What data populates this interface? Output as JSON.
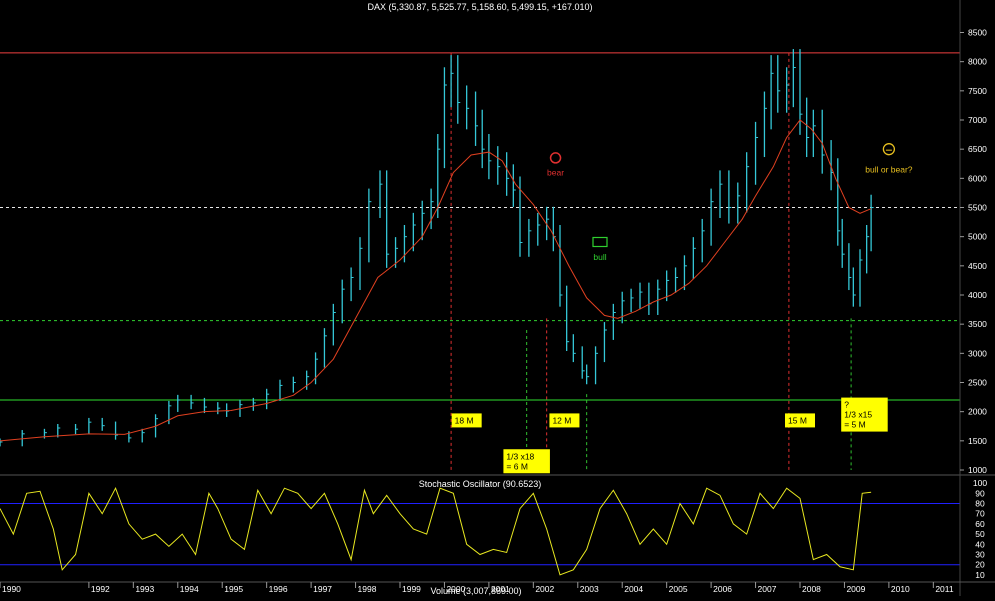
{
  "chart_data": [
    {
      "type": "ohlc",
      "title": "DAX (5,330.87, 5,525.77, 5,158.60, 5,499.15, +167.010)",
      "ylim": [
        1000,
        8800
      ],
      "yticks": [
        1000,
        1500,
        2000,
        2500,
        3000,
        3500,
        4000,
        4500,
        5000,
        5500,
        6000,
        6500,
        7000,
        7500,
        8000,
        8500
      ],
      "xlim": [
        1990.0,
        2011.6
      ],
      "xticks": [
        "1990",
        "1992",
        "1993",
        "1994",
        "1995",
        "1996",
        "1997",
        "1998",
        "1999",
        "2000",
        "2001",
        "2002",
        "2003",
        "2004",
        "2005",
        "2006",
        "2007",
        "2008",
        "2009",
        "2010",
        "2011"
      ],
      "xtick_years": [
        1990,
        1992,
        1993,
        1994,
        1995,
        1996,
        1997,
        1998,
        1999,
        2000,
        2001,
        2002,
        2003,
        2004,
        2005,
        2006,
        2007,
        2008,
        2009,
        2010,
        2011
      ],
      "grid": false,
      "series": [
        {
          "style": "bars",
          "color": "#35c8d8",
          "points": [
            [
              1990.0,
              1480
            ],
            [
              1990.5,
              1620
            ],
            [
              1991.0,
              1640
            ],
            [
              1991.3,
              1720
            ],
            [
              1991.7,
              1700
            ],
            [
              1992.0,
              1820
            ],
            [
              1992.3,
              1760
            ],
            [
              1992.6,
              1600
            ],
            [
              1992.9,
              1550
            ],
            [
              1993.2,
              1640
            ],
            [
              1993.5,
              1880
            ],
            [
              1993.8,
              2100
            ],
            [
              1994.0,
              2200
            ],
            [
              1994.3,
              2150
            ],
            [
              1994.6,
              2080
            ],
            [
              1994.9,
              2060
            ],
            [
              1995.1,
              2010
            ],
            [
              1995.4,
              2120
            ],
            [
              1995.7,
              2150
            ],
            [
              1996.0,
              2300
            ],
            [
              1996.3,
              2450
            ],
            [
              1996.6,
              2500
            ],
            [
              1996.9,
              2600
            ],
            [
              1997.1,
              2900
            ],
            [
              1997.3,
              3300
            ],
            [
              1997.5,
              3700
            ],
            [
              1997.7,
              4100
            ],
            [
              1997.9,
              4300
            ],
            [
              1998.1,
              4800
            ],
            [
              1998.3,
              5600
            ],
            [
              1998.55,
              5900
            ],
            [
              1998.7,
              4700
            ],
            [
              1998.9,
              4800
            ],
            [
              1999.1,
              5000
            ],
            [
              1999.3,
              5200
            ],
            [
              1999.5,
              5400
            ],
            [
              1999.7,
              5600
            ],
            [
              1999.85,
              6500
            ],
            [
              2000.0,
              7600
            ],
            [
              2000.15,
              7800
            ],
            [
              2000.3,
              7300
            ],
            [
              2000.5,
              7200
            ],
            [
              2000.7,
              6900
            ],
            [
              2000.85,
              6500
            ],
            [
              2001.0,
              6300
            ],
            [
              2001.2,
              6200
            ],
            [
              2001.4,
              6000
            ],
            [
              2001.55,
              5800
            ],
            [
              2001.7,
              4900
            ],
            [
              2001.9,
              5100
            ],
            [
              2002.1,
              5200
            ],
            [
              2002.3,
              5300
            ],
            [
              2002.45,
              5000
            ],
            [
              2002.6,
              4000
            ],
            [
              2002.75,
              3200
            ],
            [
              2002.9,
              3000
            ],
            [
              2003.1,
              2700
            ],
            [
              2003.2,
              2600
            ],
            [
              2003.4,
              3000
            ],
            [
              2003.6,
              3400
            ],
            [
              2003.8,
              3700
            ],
            [
              2004.0,
              3900
            ],
            [
              2004.2,
              3950
            ],
            [
              2004.4,
              4050
            ],
            [
              2004.6,
              3850
            ],
            [
              2004.8,
              4100
            ],
            [
              2005.0,
              4250
            ],
            [
              2005.2,
              4300
            ],
            [
              2005.4,
              4500
            ],
            [
              2005.6,
              4800
            ],
            [
              2005.8,
              5100
            ],
            [
              2006.0,
              5600
            ],
            [
              2006.2,
              5900
            ],
            [
              2006.4,
              5500
            ],
            [
              2006.6,
              5700
            ],
            [
              2006.8,
              6200
            ],
            [
              2007.0,
              6700
            ],
            [
              2007.2,
              7200
            ],
            [
              2007.35,
              7800
            ],
            [
              2007.5,
              7500
            ],
            [
              2007.7,
              7600
            ],
            [
              2007.85,
              7900
            ],
            [
              2008.0,
              7100
            ],
            [
              2008.15,
              6700
            ],
            [
              2008.3,
              6900
            ],
            [
              2008.5,
              6400
            ],
            [
              2008.7,
              6100
            ],
            [
              2008.85,
              5100
            ],
            [
              2008.95,
              4700
            ],
            [
              2009.1,
              4300
            ],
            [
              2009.2,
              4000
            ],
            [
              2009.35,
              4600
            ],
            [
              2009.5,
              5000
            ],
            [
              2009.6,
              5499
            ]
          ]
        },
        {
          "style": "line",
          "color": "#e04020",
          "points": [
            [
              1990.0,
              1500
            ],
            [
              1991.0,
              1570
            ],
            [
              1992.0,
              1620
            ],
            [
              1992.8,
              1610
            ],
            [
              1993.5,
              1750
            ],
            [
              1994.0,
              1930
            ],
            [
              1994.6,
              2000
            ],
            [
              1995.2,
              2020
            ],
            [
              1996.0,
              2140
            ],
            [
              1996.6,
              2280
            ],
            [
              1997.0,
              2500
            ],
            [
              1997.5,
              2900
            ],
            [
              1998.0,
              3600
            ],
            [
              1998.5,
              4300
            ],
            [
              1999.0,
              4600
            ],
            [
              1999.5,
              5000
            ],
            [
              1999.85,
              5500
            ],
            [
              2000.2,
              6100
            ],
            [
              2000.6,
              6400
            ],
            [
              2001.0,
              6450
            ],
            [
              2001.3,
              6300
            ],
            [
              2001.6,
              5900
            ],
            [
              2002.0,
              5550
            ],
            [
              2002.4,
              5100
            ],
            [
              2002.8,
              4500
            ],
            [
              2003.2,
              3950
            ],
            [
              2003.6,
              3650
            ],
            [
              2003.9,
              3600
            ],
            [
              2004.3,
              3720
            ],
            [
              2004.7,
              3880
            ],
            [
              2005.1,
              4000
            ],
            [
              2005.5,
              4200
            ],
            [
              2005.9,
              4500
            ],
            [
              2006.3,
              4900
            ],
            [
              2006.7,
              5300
            ],
            [
              2007.0,
              5700
            ],
            [
              2007.4,
              6200
            ],
            [
              2007.7,
              6700
            ],
            [
              2008.0,
              7000
            ],
            [
              2008.25,
              6850
            ],
            [
              2008.5,
              6600
            ],
            [
              2008.8,
              6000
            ],
            [
              2009.1,
              5500
            ],
            [
              2009.35,
              5400
            ],
            [
              2009.6,
              5480
            ]
          ]
        }
      ],
      "hlines": [
        {
          "y": 8150,
          "color": "#f04040",
          "style": "solid"
        },
        {
          "y": 5500,
          "color": "#e8e8e8",
          "style": "dashed"
        },
        {
          "y": 3560,
          "color": "#30d030",
          "style": "dashed"
        },
        {
          "y": 2200,
          "color": "#30e030",
          "style": "solid"
        }
      ],
      "vlines": [
        {
          "x": 2000.15,
          "y_from": 8150,
          "y_to": 1000,
          "color": "#e03030"
        },
        {
          "x": 2001.85,
          "y_from": 3400,
          "y_to": 1000,
          "color": "#30c030"
        },
        {
          "x": 2002.3,
          "y_from": 3600,
          "y_to": 1000,
          "color": "#e03030"
        },
        {
          "x": 2003.2,
          "y_from": 2300,
          "y_to": 1000,
          "color": "#30c030"
        },
        {
          "x": 2007.75,
          "y_from": 8150,
          "y_to": 1000,
          "color": "#e03030"
        },
        {
          "x": 2009.15,
          "y_from": 3600,
          "y_to": 1000,
          "color": "#30c030"
        }
      ],
      "annotations": [
        {
          "text": "18 M",
          "x": 2000.5,
          "y": 1850,
          "boxed": true
        },
        {
          "text": "1/3 x18 = 6 M",
          "x": 2001.85,
          "y": 1150,
          "boxed": true
        },
        {
          "text": "12 M",
          "x": 2002.7,
          "y": 1850,
          "boxed": true
        },
        {
          "text": "15 M",
          "x": 2008.0,
          "y": 1850,
          "boxed": true
        },
        {
          "text": "? 1/3 x15 = 5 M",
          "x": 2009.45,
          "y": 1950,
          "boxed": true
        },
        {
          "text": "bear",
          "x": 2002.5,
          "y": 6050,
          "color": "#e03030"
        },
        {
          "text": "bull",
          "x": 2003.5,
          "y": 4600,
          "color": "#30d030"
        },
        {
          "text": "bull or bear?",
          "x": 2010.0,
          "y": 6100,
          "color": "#e8c020"
        }
      ]
    },
    {
      "type": "line",
      "title": "Stochastic Oscillator (90.6523)",
      "ylim": [
        5,
        105
      ],
      "yticks": [
        10,
        20,
        30,
        40,
        50,
        60,
        70,
        80,
        90,
        100
      ],
      "hlines": [
        {
          "y": 80,
          "color": "#2020ff",
          "style": "solid"
        },
        {
          "y": 20,
          "color": "#2020ff",
          "style": "solid"
        }
      ],
      "series": [
        {
          "color": "#e8e820",
          "points": [
            [
              1990.0,
              75
            ],
            [
              1990.3,
              50
            ],
            [
              1990.6,
              90
            ],
            [
              1990.9,
              92
            ],
            [
              1991.2,
              55
            ],
            [
              1991.4,
              15
            ],
            [
              1991.7,
              30
            ],
            [
              1992.0,
              90
            ],
            [
              1992.3,
              70
            ],
            [
              1992.6,
              95
            ],
            [
              1992.9,
              60
            ],
            [
              1993.2,
              45
            ],
            [
              1993.5,
              50
            ],
            [
              1993.8,
              38
            ],
            [
              1994.1,
              50
            ],
            [
              1994.4,
              30
            ],
            [
              1994.7,
              90
            ],
            [
              1994.9,
              75
            ],
            [
              1995.2,
              45
            ],
            [
              1995.5,
              35
            ],
            [
              1995.8,
              93
            ],
            [
              1996.1,
              70
            ],
            [
              1996.4,
              95
            ],
            [
              1996.7,
              90
            ],
            [
              1997.0,
              75
            ],
            [
              1997.3,
              90
            ],
            [
              1997.6,
              60
            ],
            [
              1997.9,
              25
            ],
            [
              1998.2,
              93
            ],
            [
              1998.4,
              70
            ],
            [
              1998.7,
              88
            ],
            [
              1999.0,
              70
            ],
            [
              1999.3,
              55
            ],
            [
              1999.6,
              50
            ],
            [
              1999.9,
              95
            ],
            [
              2000.2,
              90
            ],
            [
              2000.5,
              40
            ],
            [
              2000.8,
              30
            ],
            [
              2001.1,
              35
            ],
            [
              2001.4,
              32
            ],
            [
              2001.7,
              75
            ],
            [
              2002.0,
              90
            ],
            [
              2002.3,
              55
            ],
            [
              2002.6,
              10
            ],
            [
              2002.9,
              15
            ],
            [
              2003.2,
              35
            ],
            [
              2003.5,
              75
            ],
            [
              2003.8,
              93
            ],
            [
              2004.1,
              70
            ],
            [
              2004.4,
              40
            ],
            [
              2004.7,
              55
            ],
            [
              2005.0,
              40
            ],
            [
              2005.3,
              80
            ],
            [
              2005.6,
              60
            ],
            [
              2005.9,
              95
            ],
            [
              2006.2,
              88
            ],
            [
              2006.5,
              60
            ],
            [
              2006.8,
              50
            ],
            [
              2007.1,
              90
            ],
            [
              2007.4,
              75
            ],
            [
              2007.7,
              95
            ],
            [
              2008.0,
              85
            ],
            [
              2008.3,
              25
            ],
            [
              2008.6,
              30
            ],
            [
              2008.9,
              18
            ],
            [
              2009.2,
              15
            ],
            [
              2009.4,
              90
            ],
            [
              2009.6,
              91
            ]
          ]
        }
      ]
    }
  ],
  "footer": {
    "volume_text": "Volume (3,007,869.00)"
  }
}
